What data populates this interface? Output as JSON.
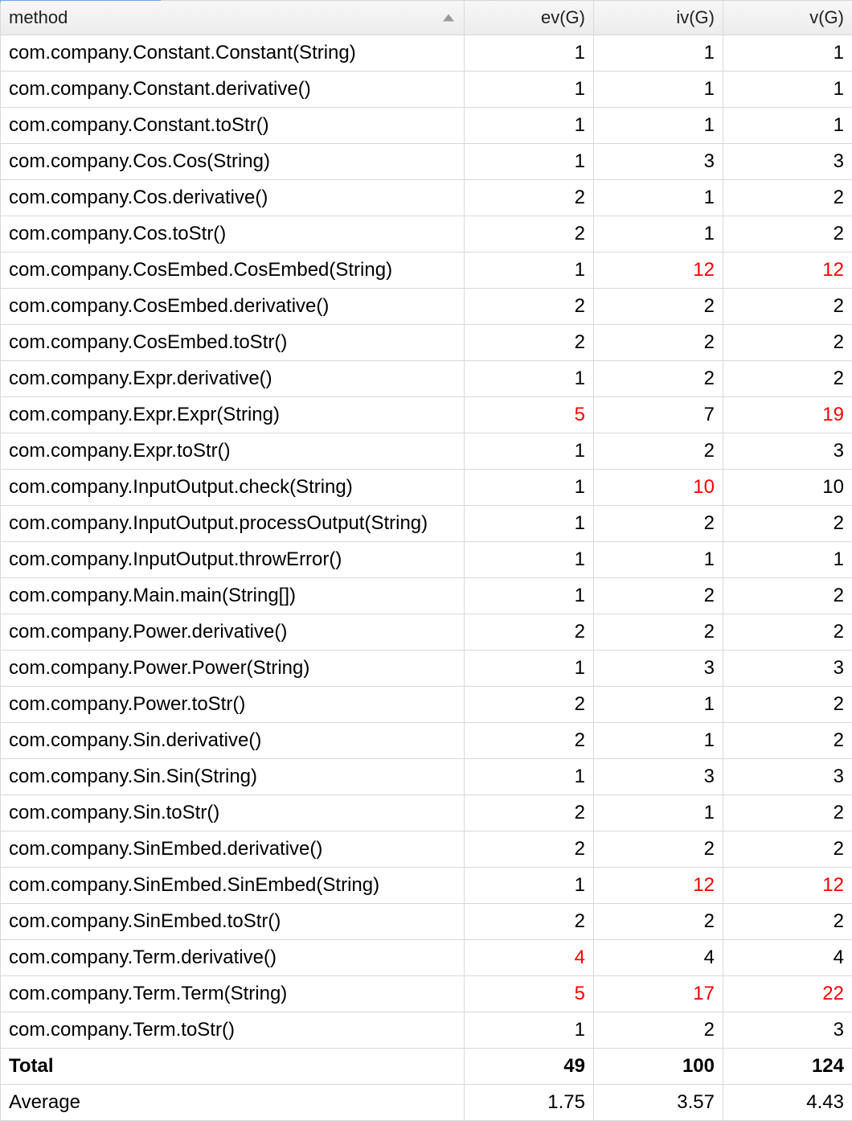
{
  "columns": {
    "method": "method",
    "ev": "ev(G)",
    "iv": "iv(G)",
    "v": "v(G)"
  },
  "rows": [
    {
      "method": "com.company.Constant.Constant(String)",
      "ev": "1",
      "iv": "1",
      "v": "1"
    },
    {
      "method": "com.company.Constant.derivative()",
      "ev": "1",
      "iv": "1",
      "v": "1"
    },
    {
      "method": "com.company.Constant.toStr()",
      "ev": "1",
      "iv": "1",
      "v": "1"
    },
    {
      "method": "com.company.Cos.Cos(String)",
      "ev": "1",
      "iv": "3",
      "v": "3"
    },
    {
      "method": "com.company.Cos.derivative()",
      "ev": "2",
      "iv": "1",
      "v": "2"
    },
    {
      "method": "com.company.Cos.toStr()",
      "ev": "2",
      "iv": "1",
      "v": "2"
    },
    {
      "method": "com.company.CosEmbed.CosEmbed(String)",
      "ev": "1",
      "iv": "12",
      "v": "12",
      "iv_red": true,
      "v_red": true
    },
    {
      "method": "com.company.CosEmbed.derivative()",
      "ev": "2",
      "iv": "2",
      "v": "2"
    },
    {
      "method": "com.company.CosEmbed.toStr()",
      "ev": "2",
      "iv": "2",
      "v": "2"
    },
    {
      "method": "com.company.Expr.derivative()",
      "ev": "1",
      "iv": "2",
      "v": "2"
    },
    {
      "method": "com.company.Expr.Expr(String)",
      "ev": "5",
      "iv": "7",
      "v": "19",
      "ev_red": true,
      "v_red": true
    },
    {
      "method": "com.company.Expr.toStr()",
      "ev": "1",
      "iv": "2",
      "v": "3"
    },
    {
      "method": "com.company.InputOutput.check(String)",
      "ev": "1",
      "iv": "10",
      "v": "10",
      "iv_red": true
    },
    {
      "method": "com.company.InputOutput.processOutput(String)",
      "ev": "1",
      "iv": "2",
      "v": "2"
    },
    {
      "method": "com.company.InputOutput.throwError()",
      "ev": "1",
      "iv": "1",
      "v": "1"
    },
    {
      "method": "com.company.Main.main(String[])",
      "ev": "1",
      "iv": "2",
      "v": "2"
    },
    {
      "method": "com.company.Power.derivative()",
      "ev": "2",
      "iv": "2",
      "v": "2"
    },
    {
      "method": "com.company.Power.Power(String)",
      "ev": "1",
      "iv": "3",
      "v": "3"
    },
    {
      "method": "com.company.Power.toStr()",
      "ev": "2",
      "iv": "1",
      "v": "2"
    },
    {
      "method": "com.company.Sin.derivative()",
      "ev": "2",
      "iv": "1",
      "v": "2"
    },
    {
      "method": "com.company.Sin.Sin(String)",
      "ev": "1",
      "iv": "3",
      "v": "3"
    },
    {
      "method": "com.company.Sin.toStr()",
      "ev": "2",
      "iv": "1",
      "v": "2"
    },
    {
      "method": "com.company.SinEmbed.derivative()",
      "ev": "2",
      "iv": "2",
      "v": "2"
    },
    {
      "method": "com.company.SinEmbed.SinEmbed(String)",
      "ev": "1",
      "iv": "12",
      "v": "12",
      "iv_red": true,
      "v_red": true
    },
    {
      "method": "com.company.SinEmbed.toStr()",
      "ev": "2",
      "iv": "2",
      "v": "2"
    },
    {
      "method": "com.company.Term.derivative()",
      "ev": "4",
      "iv": "4",
      "v": "4",
      "ev_red": true
    },
    {
      "method": "com.company.Term.Term(String)",
      "ev": "5",
      "iv": "17",
      "v": "22",
      "ev_red": true,
      "iv_red": true,
      "v_red": true
    },
    {
      "method": "com.company.Term.toStr()",
      "ev": "1",
      "iv": "2",
      "v": "3"
    }
  ],
  "total": {
    "label": "Total",
    "ev": "49",
    "iv": "100",
    "v": "124"
  },
  "average": {
    "label": "Average",
    "ev": "1.75",
    "iv": "3.57",
    "v": "4.43"
  }
}
